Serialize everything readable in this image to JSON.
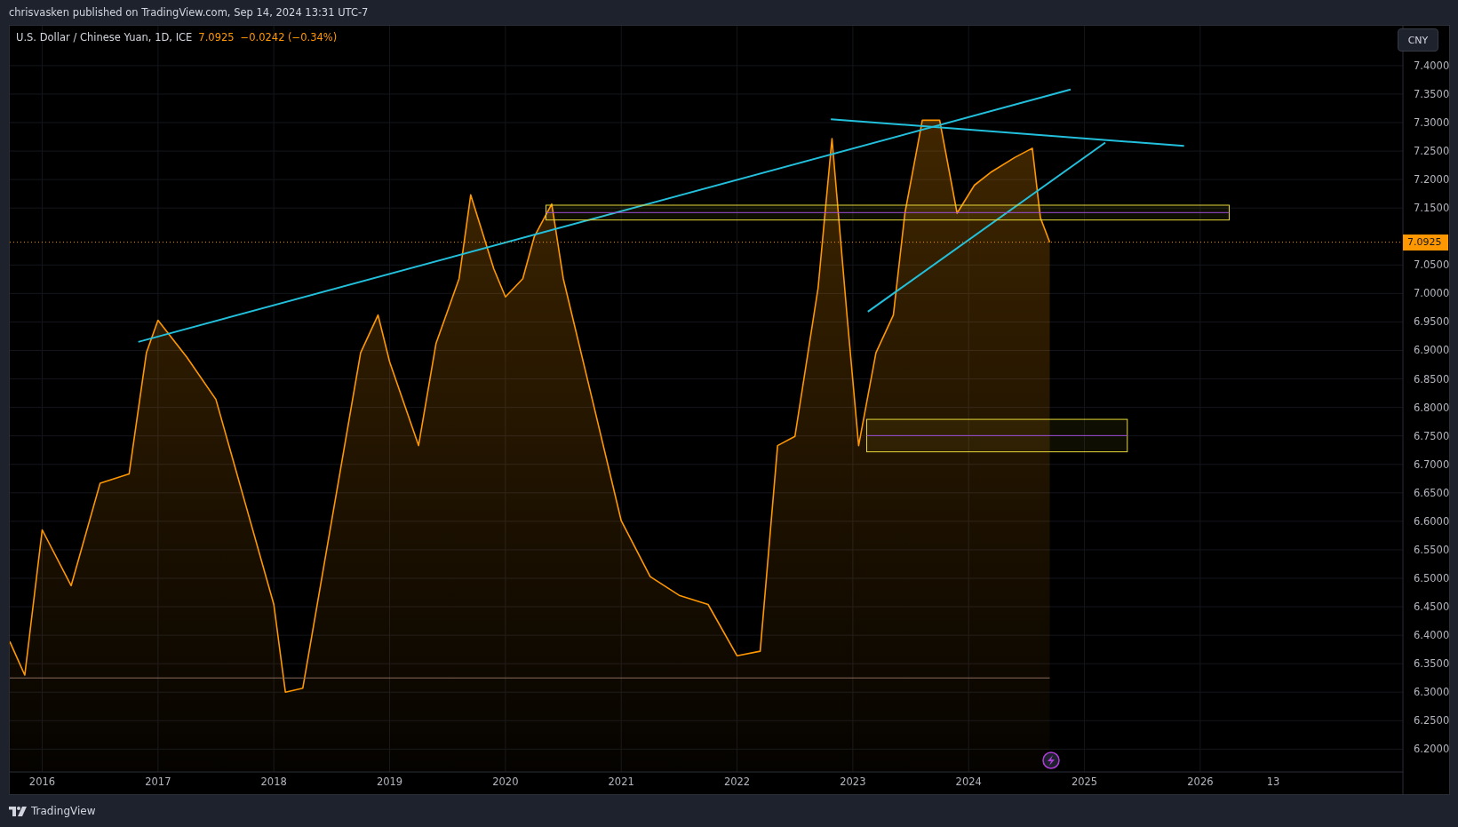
{
  "header": {
    "text": "chrisvasken published on TradingView.com, Sep 14, 2024 13:31 UTC-7"
  },
  "legend": {
    "symbol": "U.S. Dollar / Chinese Yuan, 1D, ICE",
    "price": "7.0925",
    "change": "−0.0242 (−0.34%)"
  },
  "currency_button": "CNY",
  "price_label": "7.0925",
  "time_axis_extra_label": "13",
  "drawings": [
    {
      "kind": "trendline"
    },
    {
      "kind": "trendline"
    },
    {
      "kind": "trendline"
    },
    {
      "kind": "zone"
    },
    {
      "kind": "zone"
    },
    {
      "kind": "hline"
    }
  ],
  "chart_data": {
    "type": "area",
    "grid": true,
    "x": [
      2015.72,
      2015.85,
      2016.0,
      2016.25,
      2016.5,
      2016.75,
      2016.9,
      2017.0,
      2017.25,
      2017.5,
      2017.75,
      2018.0,
      2018.1,
      2018.25,
      2018.5,
      2018.75,
      2018.9,
      2019.0,
      2019.25,
      2019.4,
      2019.6,
      2019.7,
      2019.9,
      2020.0,
      2020.15,
      2020.25,
      2020.4,
      2020.5,
      2020.75,
      2021.0,
      2021.25,
      2021.5,
      2021.75,
      2022.0,
      2022.2,
      2022.35,
      2022.5,
      2022.7,
      2022.82,
      2022.95,
      2023.05,
      2023.2,
      2023.35,
      2023.45,
      2023.6,
      2023.75,
      2023.9,
      2024.05,
      2024.2,
      2024.4,
      2024.55,
      2024.62,
      2024.7
    ],
    "series": [
      {
        "color": "#ff9800",
        "values": [
          6.389,
          6.33,
          6.585,
          6.487,
          6.667,
          6.683,
          6.896,
          6.953,
          6.888,
          6.814,
          6.634,
          6.454,
          6.3,
          6.307,
          6.601,
          6.896,
          6.962,
          6.88,
          6.733,
          6.912,
          7.026,
          7.173,
          7.043,
          6.994,
          7.026,
          7.1,
          7.157,
          7.026,
          6.814,
          6.601,
          6.503,
          6.47,
          6.454,
          6.364,
          6.372,
          6.733,
          6.749,
          7.01,
          7.272,
          6.96,
          6.733,
          6.896,
          6.962,
          7.141,
          7.304,
          7.304,
          7.141,
          7.19,
          7.214,
          7.239,
          7.255,
          7.133,
          7.09
        ]
      }
    ],
    "xlim": [
      2015.72,
      2027.75
    ],
    "ylim": [
      6.16,
      7.47
    ],
    "xticks": [
      {
        "value": 2016,
        "label": "2016"
      },
      {
        "value": 2017,
        "label": "2017"
      },
      {
        "value": 2018,
        "label": "2018"
      },
      {
        "value": 2019,
        "label": "2019"
      },
      {
        "value": 2020,
        "label": "2020"
      },
      {
        "value": 2021,
        "label": "2021"
      },
      {
        "value": 2022,
        "label": "2022"
      },
      {
        "value": 2023,
        "label": "2023"
      },
      {
        "value": 2024,
        "label": "2024"
      },
      {
        "value": 2025,
        "label": "2025"
      },
      {
        "value": 2026,
        "label": "2026"
      }
    ],
    "yticks": [
      {
        "value": 7.4,
        "label": "7.4000"
      },
      {
        "value": 7.35,
        "label": "7.3500"
      },
      {
        "value": 7.3,
        "label": "7.3000"
      },
      {
        "value": 7.25,
        "label": "7.2500"
      },
      {
        "value": 7.2,
        "label": "7.2000"
      },
      {
        "value": 7.15,
        "label": "7.1500"
      },
      {
        "value": 7.05,
        "label": "7.0500"
      },
      {
        "value": 7.0,
        "label": "7.0000"
      },
      {
        "value": 6.95,
        "label": "6.9500"
      },
      {
        "value": 6.9,
        "label": "6.9000"
      },
      {
        "value": 6.85,
        "label": "6.8500"
      },
      {
        "value": 6.8,
        "label": "6.8000"
      },
      {
        "value": 6.75,
        "label": "6.7500"
      },
      {
        "value": 6.7,
        "label": "6.7000"
      },
      {
        "value": 6.65,
        "label": "6.6500"
      },
      {
        "value": 6.6,
        "label": "6.6000"
      },
      {
        "value": 6.55,
        "label": "6.5500"
      },
      {
        "value": 6.5,
        "label": "6.5000"
      },
      {
        "value": 6.45,
        "label": "6.4500"
      },
      {
        "value": 6.4,
        "label": "6.4000"
      },
      {
        "value": 6.35,
        "label": "6.3500"
      },
      {
        "value": 6.3,
        "label": "6.3000"
      },
      {
        "value": 6.25,
        "label": "6.2500"
      },
      {
        "value": 6.2,
        "label": "6.2000"
      }
    ],
    "orientation": "vertical"
  },
  "footer": {
    "logo_text": "TradingView"
  }
}
